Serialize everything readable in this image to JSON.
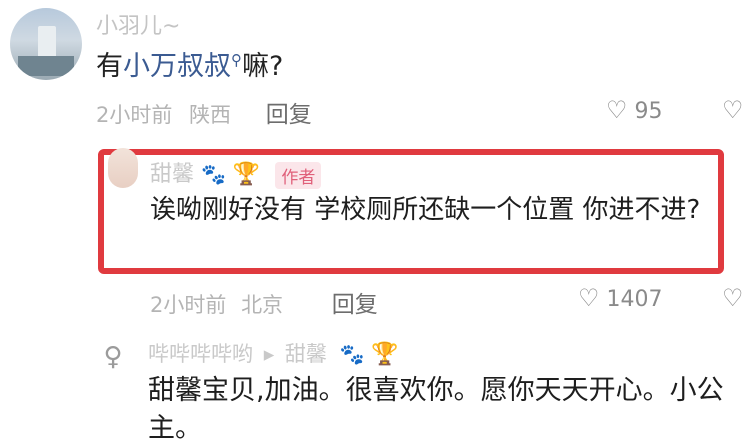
{
  "comment": {
    "username": "小羽儿~",
    "text_prefix": "有",
    "text_link": "小万叔叔",
    "text_suffix": "嘛?",
    "time": "2小时前",
    "location": "陕西",
    "reply_label": "回复",
    "likes": "95"
  },
  "author_reply": {
    "username": "甜馨",
    "badge": "作者",
    "text": "诶呦刚好没有 学校厕所还缺一个位置 你进不进?",
    "time": "2小时前",
    "location": "北京",
    "reply_label": "回复",
    "likes": "1407"
  },
  "sub_reply": {
    "username": "哔哔哔哔哟",
    "arrow": "▸",
    "target": "甜馨",
    "text": "甜馨宝贝,加油。很喜欢你。愿你天天开心。小公主。"
  },
  "icons": {
    "like": "heart-outline-icon",
    "dislike": "broken-heart-icon",
    "paw": "paw-icon",
    "trophy": "trophy-icon",
    "search": "search-icon"
  },
  "colors": {
    "highlight_border": "#e03a3f",
    "author_badge_bg": "#fbe6ea",
    "author_badge_text": "#e0607a",
    "link": "#3b5b92"
  }
}
